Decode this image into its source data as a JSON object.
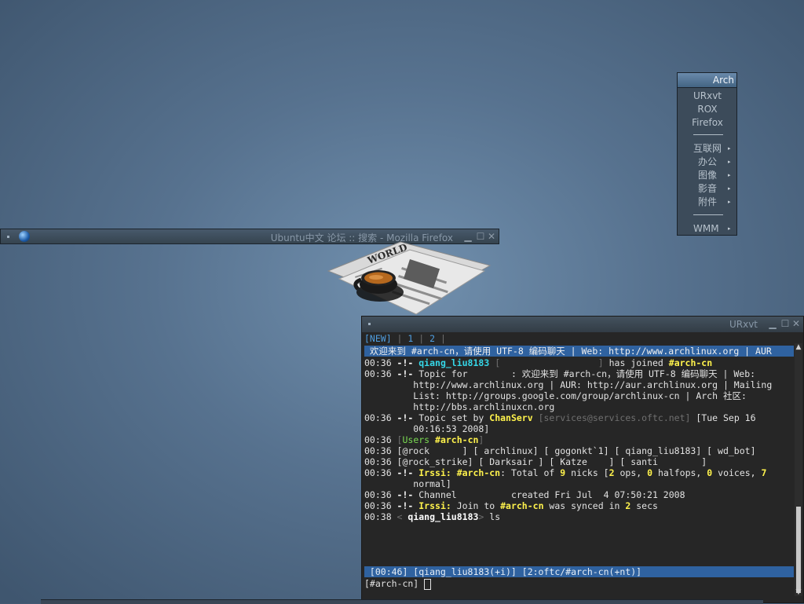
{
  "firefox_window": {
    "title": "Ubuntu中文 论坛 :: 搜索 - Mozilla Firefox",
    "menu_icon": "dot-icon",
    "app_icon": "globe-icon",
    "buttons": [
      "minimize-icon",
      "maximize-icon",
      "close-icon"
    ]
  },
  "wallpaper": {
    "newspaper_headline": "WORLD"
  },
  "root_menu": {
    "header": "Arch",
    "apps": [
      "URxvt",
      "ROX",
      "Firefox"
    ],
    "submenus": [
      "互联网",
      "办公",
      "图像",
      "影音",
      "附件"
    ],
    "wm": "WMM",
    "arrow": "▸"
  },
  "urxvt_window": {
    "title": "URxvt",
    "buttons": [
      "minimize-icon",
      "maximize-icon",
      "close-icon"
    ]
  },
  "irssi": {
    "window_bar": {
      "new": "[NEW]",
      "sep1": " | ",
      "w1": "1",
      "sep2": " | ",
      "w2": "2",
      "sep3": " |"
    },
    "topic_bar": " 欢迎来到 #arch-cn，请使用 UTF-8 编码聊天 | Web: http://www.archlinux.org | AUR",
    "lines": {
      "l1": {
        "time": "00:36",
        "mark": " -!- ",
        "nick": "qiang_liu8183",
        "host": " [                  ]",
        "text": " has joined ",
        "chan": "#arch-cn"
      },
      "l2": {
        "time": "00:36",
        "mark": " -!- ",
        "text": "Topic for        : 欢迎来到 #arch-cn，请使用 UTF-8 编码聊天 | Web:"
      },
      "l3": "         http://www.archlinux.org | AUR: http://aur.archlinux.org | Mailing",
      "l4": "         List: http://groups.google.com/group/archlinux-cn | Arch 社区:",
      "l5": "         http://bbs.archlinuxcn.org",
      "l6": {
        "time": "00:36",
        "mark": " -!- ",
        "text": "Topic set by ",
        "nick": "ChanServ",
        "host": " [services@services.oftc.net] ",
        "date": "[Tue Sep 16"
      },
      "l7": "         00:16:53 2008]",
      "l8": {
        "time": "00:36",
        "open": " [",
        "label": "Users",
        "chan": " #arch-cn",
        "close": "]"
      },
      "l9": "00:36 [@rock      ] [ archlinux] [ gogonkt`1] [ qiang_liu8183] [ wd_bot]",
      "l10": "00:36 [@rock_strike] [ Darksair ] [ Katze    ] [ santi        ]",
      "l11": {
        "time": "00:36",
        "mark": " -!- ",
        "irssi": "Irssi:",
        "chan": " #arch-cn",
        "t1": ": Total of ",
        "n1": "9",
        "t2": " nicks [",
        "n2": "2",
        "t3": " ops, ",
        "n3": "0",
        "t4": " halfops, ",
        "n4": "0",
        "t5": " voices, ",
        "n5": "7"
      },
      "l12": "         normal]",
      "l13": {
        "time": "00:36",
        "mark": " -!- ",
        "text": "Channel          created Fri Jul  4 07:50:21 2008"
      },
      "l14": {
        "time": "00:36",
        "mark": " -!- ",
        "irssi": "Irssi:",
        "t1": " Join to ",
        "chan": "#arch-cn",
        "t2": " was synced in ",
        "n": "2",
        "t3": " secs"
      },
      "l15": {
        "time": "00:38",
        "open": " < ",
        "nick": "qiang_liu8183",
        "close": "> ",
        "text": "ls"
      }
    },
    "status_bar": " [00:46] [qiang_liu8183(+i)] [2:oftc/#arch-cn(+nt)]",
    "prompt": "[#arch-cn] ",
    "cursor": " "
  },
  "colors": {
    "accent": "#2f62a0",
    "nick": "#35d7e8",
    "highlight": "#fff34c",
    "users_label": "#7adb52"
  }
}
